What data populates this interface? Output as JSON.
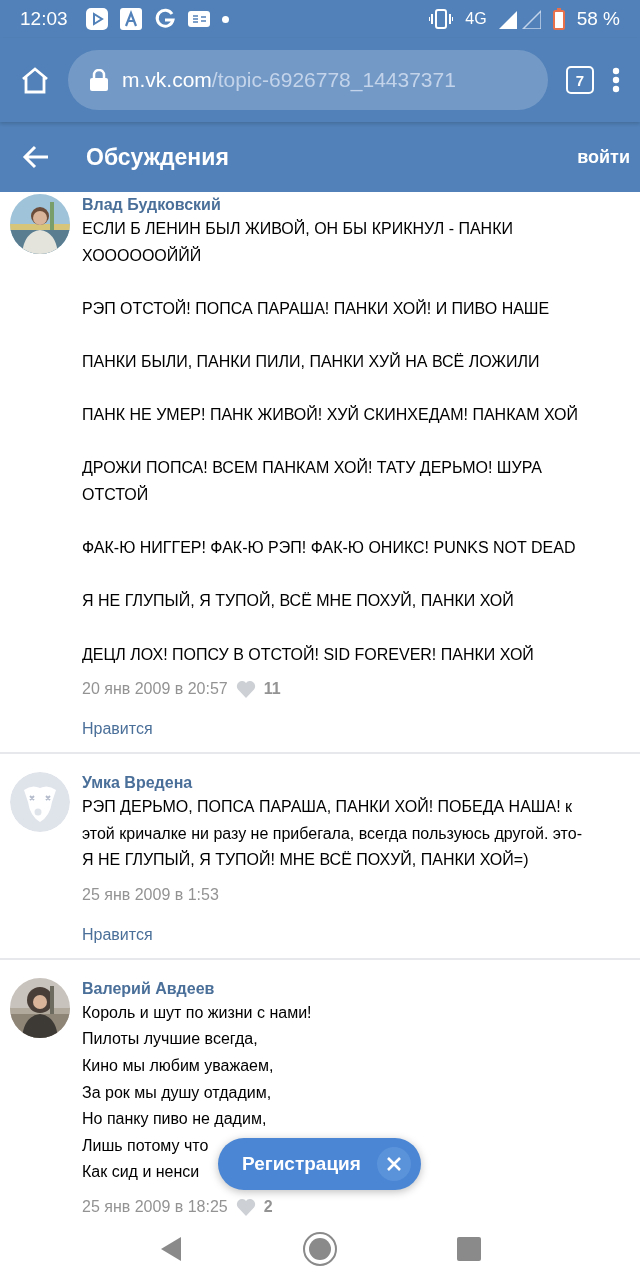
{
  "status_bar": {
    "time": "12:03",
    "network": "4G",
    "battery": "58 %"
  },
  "browser": {
    "url_host": "m.vk.com",
    "url_path": "/topic-6926778_14437371",
    "tab_count": "7"
  },
  "header": {
    "title": "Обсуждения",
    "login": "войти"
  },
  "posts": [
    {
      "author": "Влад Будковский",
      "paragraphs": [
        "ЕСЛИ Б ЛЕНИН БЫЛ ЖИВОЙ, ОН БЫ КРИКНУЛ - ПАНКИ ХООООООЙЙЙ",
        "РЭП ОТСТОЙ! ПОПСА ПАРАША! ПАНКИ ХОЙ! И ПИВО НАШЕ",
        "ПАНКИ БЫЛИ, ПАНКИ ПИЛИ, ПАНКИ ХУЙ НА ВСЁ ЛОЖИЛИ",
        "ПАНК НЕ УМЕР! ПАНК ЖИВОЙ! ХУЙ СКИНХЕДАМ! ПАНКАМ ХОЙ",
        "ДРОЖИ ПОПСА! ВСЕМ ПАНКАМ ХОЙ! ТАТУ ДЕРЬМО! ШУРА ОТСТОЙ",
        "ФАК-Ю НИГГЕР! ФАК-Ю РЭП! ФАК-Ю ОНИКС! PUNKS NOT DEAD",
        "Я НЕ ГЛУПЫЙ, Я ТУПОЙ, ВСЁ МНЕ ПОХУЙ, ПАНКИ ХОЙ",
        "ДЕЦЛ ЛОХ! ПОПСУ В ОТСТОЙ! SID FOREVER! ПАНКИ ХОЙ"
      ],
      "date": "20 янв 2009 в 20:57",
      "likes": "11",
      "like_label": "Нравится"
    },
    {
      "author": "Умка Вредена",
      "kind": "default",
      "paragraphs": [
        "РЭП ДЕРЬМО, ПОПСА ПАРАША, ПАНКИ ХОЙ! ПОБЕДА НАША! к этой кричалке ни разу не прибегала, всегда пользуюсь другой. это- Я НЕ ГЛУПЫЙ, Я ТУПОЙ! МНЕ ВСЁ ПОХУЙ, ПАНКИ ХОЙ=)"
      ],
      "date": "25 янв 2009 в 1:53",
      "like_label": "Нравится"
    },
    {
      "author": "Валерий Авдеев",
      "lines": [
        "Король и шут по жизни с нами!",
        "Пилоты лучшие всегда,",
        "Кино мы любим уважаем,",
        "За рок мы душу отдадим,",
        "Но панку пиво не дадим,",
        "Лишь потому что",
        "Как сид и ненси"
      ],
      "date": "25 янв 2009 в 18:25",
      "likes": "2"
    }
  ],
  "popup": {
    "label": "Регистрация"
  }
}
